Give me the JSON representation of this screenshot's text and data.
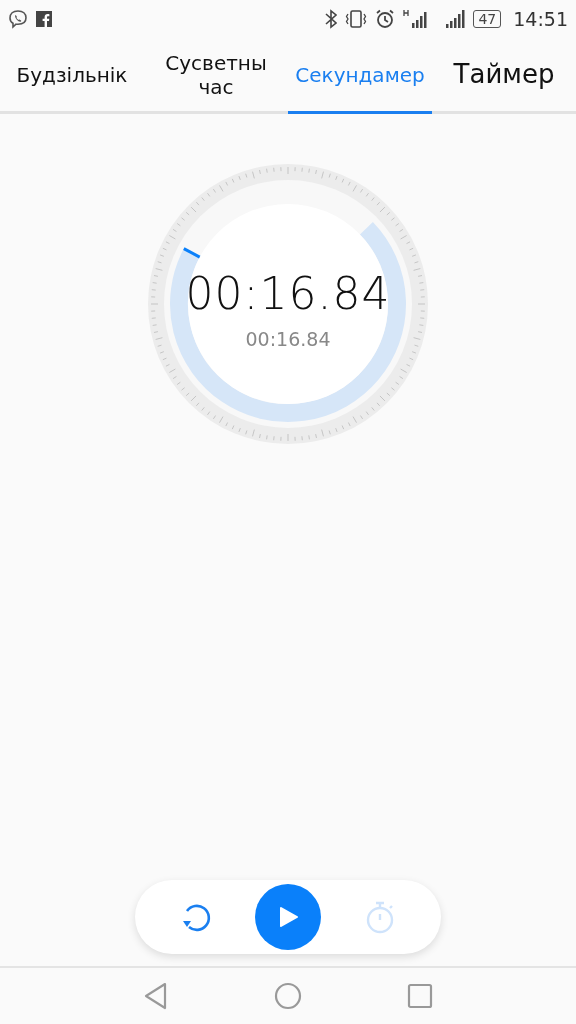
{
  "status_bar": {
    "battery": "47",
    "time": "14:51"
  },
  "tabs": [
    {
      "label": "Будзільнік",
      "selected": false
    },
    {
      "label": "Сусветны час",
      "selected": false
    },
    {
      "label": "Секундамер",
      "selected": true
    },
    {
      "label": "Таймер",
      "selected": false
    }
  ],
  "stopwatch": {
    "time": "00:16.84",
    "lap_time": "00:16.84"
  },
  "controls": [
    {
      "kind": "reset",
      "disabled": false
    },
    {
      "kind": "play",
      "disabled": false
    },
    {
      "kind": "lap",
      "disabled": true
    }
  ]
}
